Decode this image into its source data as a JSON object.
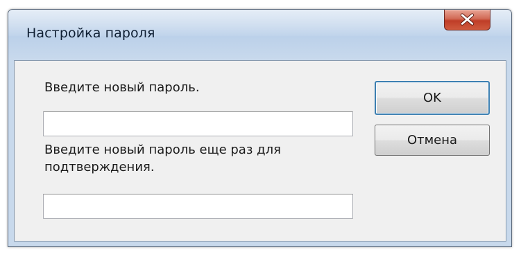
{
  "window": {
    "title": "Настройка пароля"
  },
  "form": {
    "new_password_label": "Введите новый пароль.",
    "new_password_value": "",
    "confirm_password_label": "Введите новый пароль еще раз для подтверждения.",
    "confirm_password_value": ""
  },
  "buttons": {
    "ok_label": "OK",
    "cancel_label": "Отмена"
  },
  "icons": {
    "close": "close-icon"
  },
  "colors": {
    "close_button": "#c94a32",
    "default_button_focus": "#3c7fb1",
    "dialog_background": "#f0f0f0"
  }
}
